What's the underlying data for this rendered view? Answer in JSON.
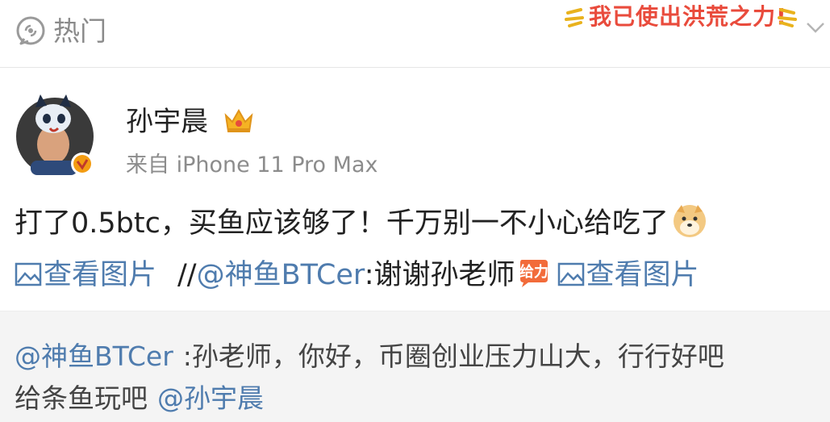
{
  "header": {
    "hot_label": "热门",
    "sticker_text": "我已使出洪荒之力!"
  },
  "post": {
    "username": "孙宇晨",
    "source": "来自 iPhone 11 Pro Max",
    "text_line1": "打了0.5btc，买鱼应该够了！千万别一不小心给吃了",
    "view_pic_1": "查看图片",
    "repost_prefix": "//",
    "mention": "@神鱼BTCer",
    "reply_text": ":谢谢孙老师",
    "view_pic_2": "查看图片"
  },
  "repost": {
    "mention": "@神鱼BTCer",
    "text_line1": ":孙老师，你好，币圈创业压力山大，行行好吧",
    "text_line2": "给条鱼玩吧",
    "mention_end": "@孙宇晨"
  },
  "colors": {
    "link": "#4f7cae",
    "crown": "#f5b323",
    "badge": "#f39c12"
  }
}
